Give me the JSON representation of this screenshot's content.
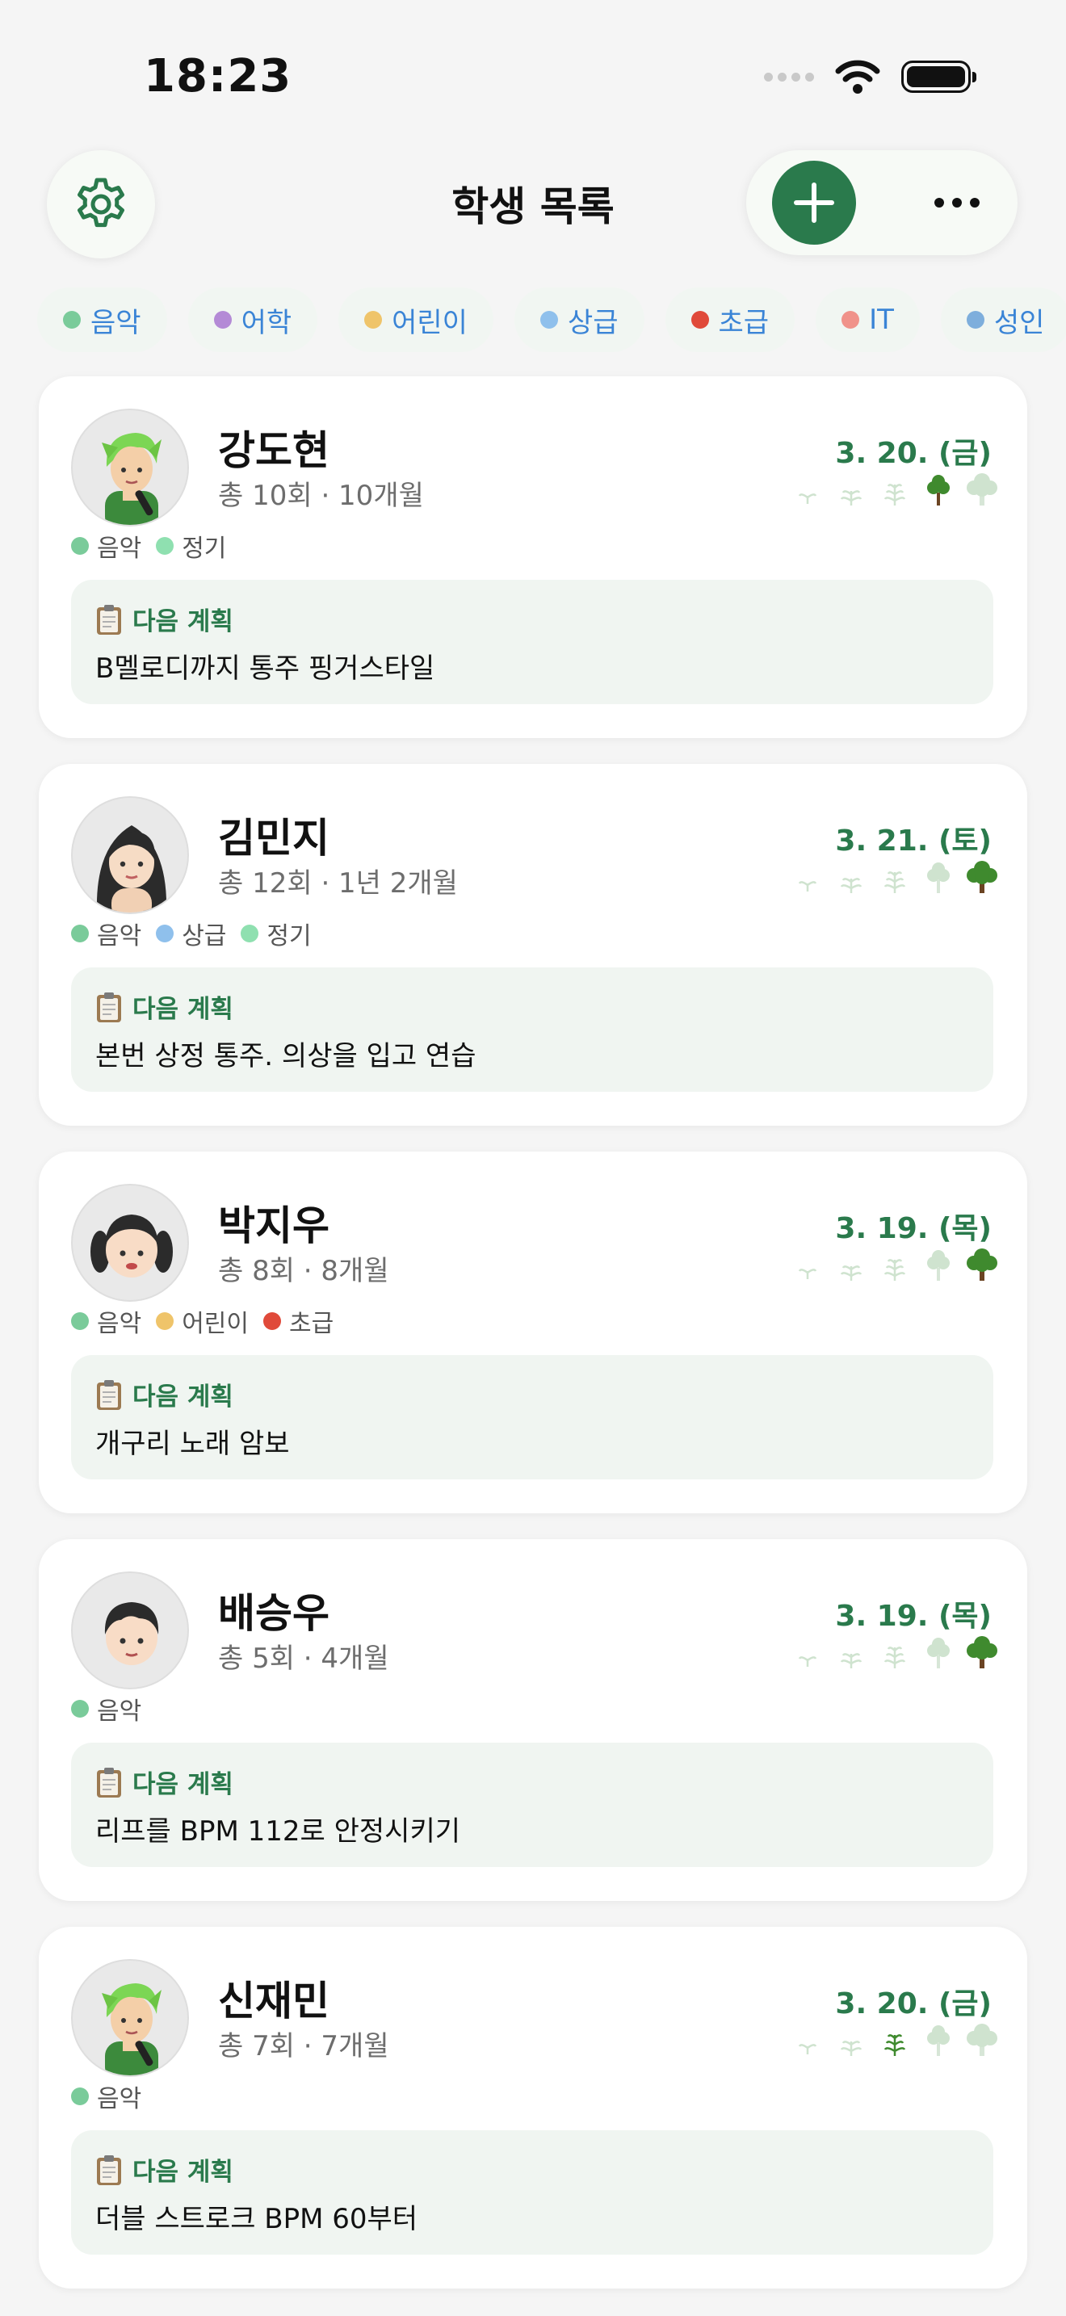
{
  "status_bar": {
    "time": "18:23"
  },
  "header": {
    "title": "학생 목록"
  },
  "colors": {
    "accent": "#2a7a4c",
    "chip_text": "#3a84d6",
    "music": "#7acb9a",
    "regular": "#8fe0b0",
    "language": "#b48ad6",
    "child": "#efc46a",
    "advanced": "#8fc0ec",
    "beginner": "#e04a3a",
    "it": "#f0928a",
    "adult": "#7eaedc"
  },
  "filter_chips": [
    {
      "label": "음악",
      "color": "#7acb9a"
    },
    {
      "label": "어학",
      "color": "#b48ad6"
    },
    {
      "label": "어린이",
      "color": "#efc46a"
    },
    {
      "label": "상급",
      "color": "#8fc0ec"
    },
    {
      "label": "초급",
      "color": "#e04a3a"
    },
    {
      "label": "IT",
      "color": "#f0928a"
    },
    {
      "label": "성인",
      "color": "#7eaedc"
    }
  ],
  "plan_heading": "다음 계획",
  "students": [
    {
      "name": "강도현",
      "meta": "총 10회 · 10개월",
      "date": "3. 20. (금)",
      "avatar": "green-hair-singer",
      "growth_level": 4,
      "tags": [
        {
          "label": "음악",
          "color": "#7acb9a"
        },
        {
          "label": "정기",
          "color": "#8fe0b0"
        }
      ],
      "plan": "B멜로디까지 통주 핑거스타일"
    },
    {
      "name": "김민지",
      "meta": "총 12회 · 1년 2개월",
      "date": "3. 21. (토)",
      "avatar": "woman-long-hair",
      "growth_level": 5,
      "tags": [
        {
          "label": "음악",
          "color": "#7acb9a"
        },
        {
          "label": "상급",
          "color": "#8fc0ec"
        },
        {
          "label": "정기",
          "color": "#8fe0b0"
        }
      ],
      "plan": "본번 상정 통주. 의상을 입고 연습"
    },
    {
      "name": "박지우",
      "meta": "총 8회 · 8개월",
      "date": "3. 19. (목)",
      "avatar": "girl-pigtails",
      "growth_level": 5,
      "tags": [
        {
          "label": "음악",
          "color": "#7acb9a"
        },
        {
          "label": "어린이",
          "color": "#efc46a"
        },
        {
          "label": "초급",
          "color": "#e04a3a"
        }
      ],
      "plan": "개구리 노래 암보"
    },
    {
      "name": "배승우",
      "meta": "총 5회 · 4개월",
      "date": "3. 19. (목)",
      "avatar": "boy",
      "growth_level": 5,
      "tags": [
        {
          "label": "음악",
          "color": "#7acb9a"
        }
      ],
      "plan": "리프를 BPM 112로 안정시키기"
    },
    {
      "name": "신재민",
      "meta": "총 7회 · 7개월",
      "date": "3. 20. (금)",
      "avatar": "green-hair-singer",
      "growth_level": 3,
      "tags": [
        {
          "label": "음악",
          "color": "#7acb9a"
        }
      ],
      "plan": "더블 스트로크 BPM 60부터"
    }
  ]
}
